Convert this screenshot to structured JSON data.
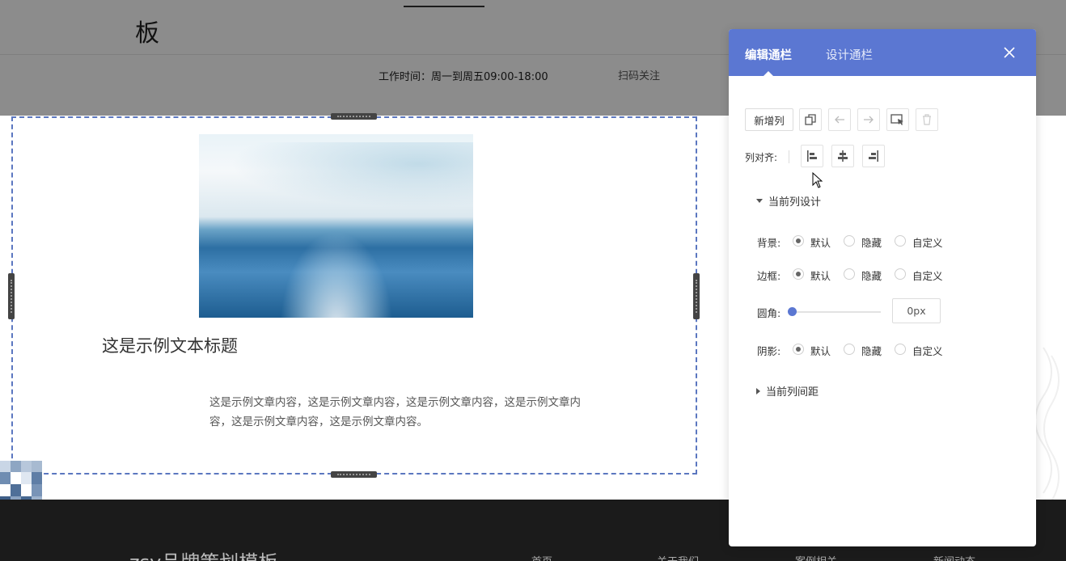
{
  "header": {
    "brand_fragment": "板",
    "work_hours": "工作时间：周一到周五09:00-18:00",
    "scan_follow": "扫码关注"
  },
  "content": {
    "title": "这是示例文本标题",
    "body": "这是示例文章内容，这是示例文章内容，这是示例文章内容，这是示例文章内容，这是示例文章内容，这是示例文章内容。"
  },
  "footer": {
    "brand": "zsy品牌策划模板",
    "nav": [
      "首页",
      "关于我们",
      "案例相关",
      "新闻动态"
    ]
  },
  "editor": {
    "tabs": [
      {
        "label": "编辑通栏",
        "active": true
      },
      {
        "label": "设计通栏",
        "active": false
      }
    ],
    "toolbar": {
      "add_column_label": "新增列",
      "icons": [
        "copy-icon",
        "arrow-left-icon",
        "arrow-right-icon",
        "select-cursor-icon",
        "trash-icon"
      ]
    },
    "column_align": {
      "label": "列对齐:",
      "options": [
        "align-left-icon",
        "align-center-icon",
        "align-right-icon"
      ]
    },
    "current_column_design": {
      "section_label": "当前列设计",
      "expanded": true,
      "background": {
        "label": "背景:",
        "options": [
          "默认",
          "隐藏",
          "自定义"
        ],
        "selected": "默认"
      },
      "border": {
        "label": "边框:",
        "options": [
          "默认",
          "隐藏",
          "自定义"
        ],
        "selected": "默认"
      },
      "radius": {
        "label": "圆角:",
        "value": "0px",
        "slider_value": 0
      },
      "shadow": {
        "label": "阴影:",
        "options": [
          "默认",
          "隐藏",
          "自定义"
        ],
        "selected": "默认"
      }
    },
    "current_column_spacing": {
      "section_label": "当前列间距",
      "expanded": false
    },
    "colors": {
      "accent": "#5b77d2",
      "selection_border": "#5b77c0"
    }
  }
}
